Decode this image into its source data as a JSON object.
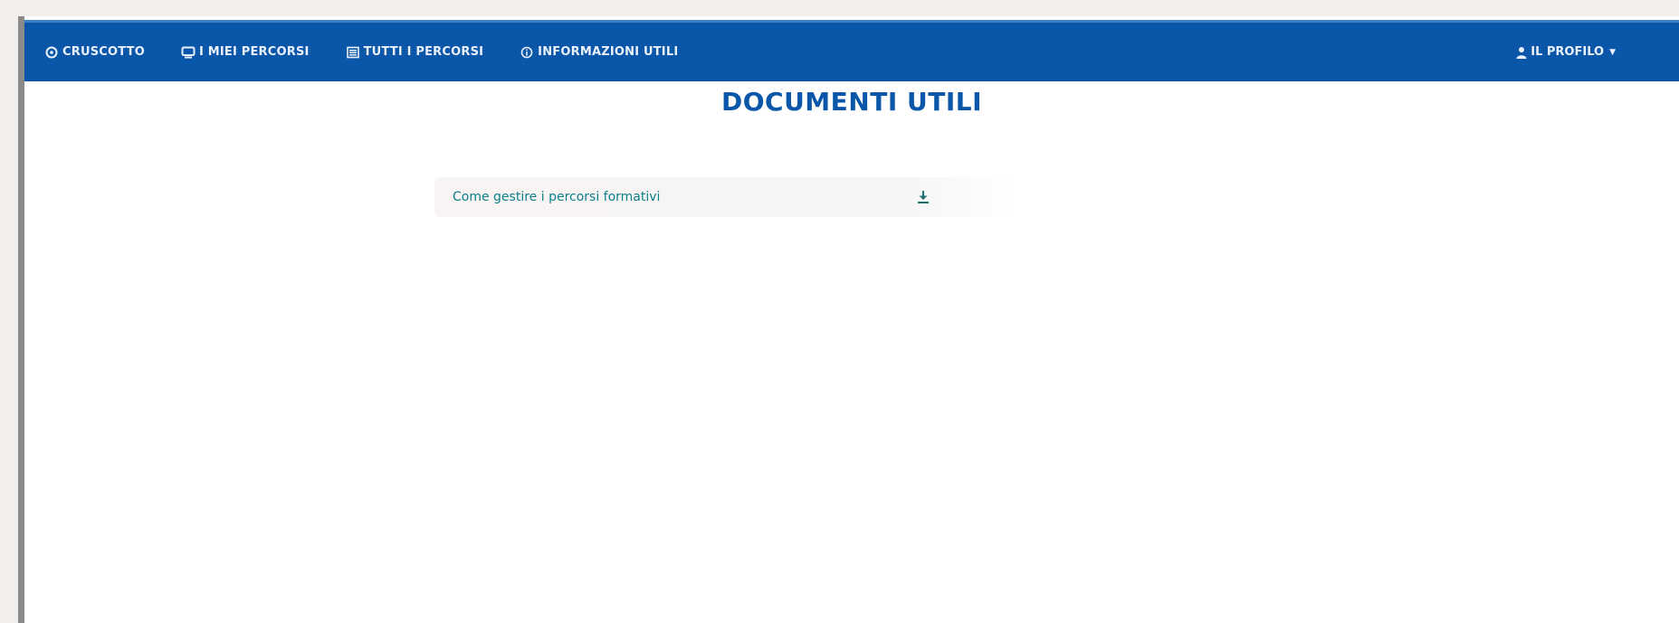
{
  "nav": {
    "items": [
      {
        "label": "CRUSCOTTO",
        "icon": "gauge-icon"
      },
      {
        "label": "I MIEI PERCORSI",
        "icon": "monitor-icon"
      },
      {
        "label": "TUTTI I PERCORSI",
        "icon": "list-icon"
      },
      {
        "label": "INFORMAZIONI UTILI",
        "icon": "info-icon"
      }
    ],
    "profile_label": "IL PROFILO",
    "profile_icon": "user-icon",
    "caret_icon": "caret-down-icon"
  },
  "main": {
    "title": "DOCUMENTI UTILI",
    "documents": [
      {
        "label": "Come gestire i percorsi formativi",
        "icon": "download-icon"
      }
    ]
  },
  "colors": {
    "brand": "#0a56a9",
    "link": "#0b7f8a"
  }
}
